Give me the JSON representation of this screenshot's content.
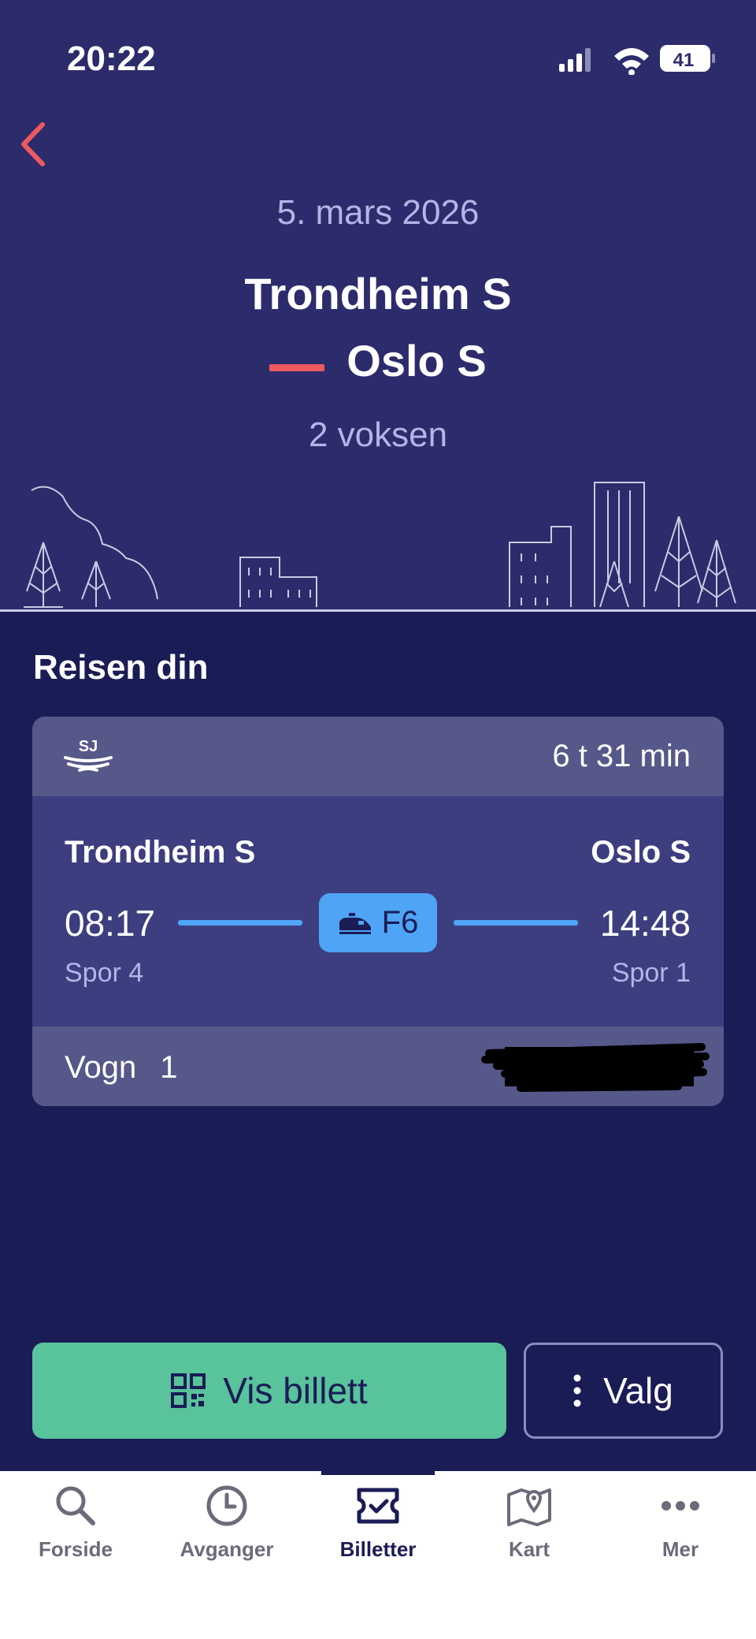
{
  "status_bar": {
    "time": "20:22",
    "battery": "41"
  },
  "header": {
    "date": "5. mars 2026",
    "from": "Trondheim S",
    "to": "Oslo S",
    "passengers": "2 voksen"
  },
  "journey": {
    "section_title": "Reisen din",
    "operator_logo": "SJ",
    "duration": "6 t 31 min",
    "from_station": "Trondheim S",
    "to_station": "Oslo S",
    "departure_time": "08:17",
    "arrival_time": "14:48",
    "train": "F6",
    "from_platform": "Spor 4",
    "to_platform": "Spor 1",
    "car_label": "Vogn",
    "car_number": "1"
  },
  "actions": {
    "show_ticket": "Vis billett",
    "options": "Valg"
  },
  "tabs": [
    {
      "label": "Forside",
      "icon": "search-icon"
    },
    {
      "label": "Avganger",
      "icon": "clock-icon"
    },
    {
      "label": "Billetter",
      "icon": "ticket-icon",
      "active": true
    },
    {
      "label": "Kart",
      "icon": "map-icon"
    },
    {
      "label": "Mer",
      "icon": "more-icon"
    }
  ],
  "colors": {
    "hero_bg": "#2c2c6c",
    "main_bg": "#1a1c56",
    "accent_red": "#ee5a5f",
    "accent_blue": "#4fa4f5",
    "accent_green": "#59c39c"
  }
}
